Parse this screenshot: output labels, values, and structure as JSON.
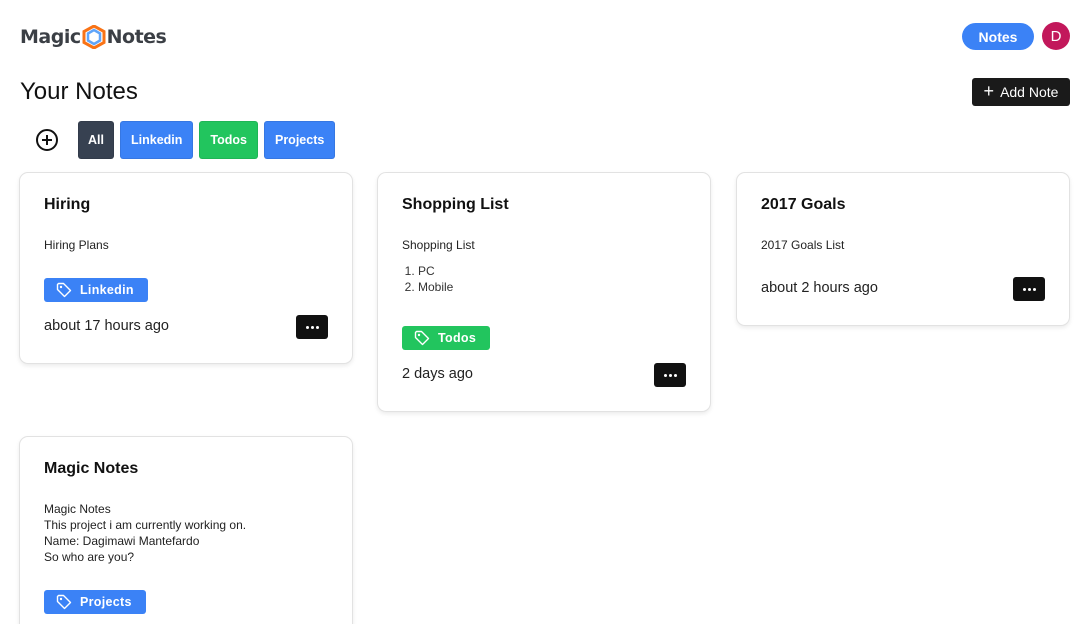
{
  "header": {
    "logo_left": "Magic",
    "logo_right": "Notes",
    "nav_notes_label": "Notes",
    "avatar_initial": "D"
  },
  "page": {
    "title": "Your Notes",
    "add_note_label": "Add Note",
    "add_note_icon": "plus-icon"
  },
  "filters": {
    "add_icon": "add-circle-icon",
    "items": [
      {
        "label": "All",
        "color": "#374151"
      },
      {
        "label": "Linkedin",
        "color": "#3b82f6"
      },
      {
        "label": "Todos",
        "color": "#22c55e"
      },
      {
        "label": "Projects",
        "color": "#3b82f6"
      }
    ]
  },
  "notes": [
    {
      "title": "Hiring",
      "body": [
        "Hiring Plans"
      ],
      "list": [],
      "tag": "Linkedin",
      "tag_color": "#3b82f6",
      "time": "about 17 hours ago"
    },
    {
      "title": "Shopping List",
      "body": [
        "Shopping List"
      ],
      "list": [
        "PC",
        "Mobile"
      ],
      "tag": "Todos",
      "tag_color": "#22c55e",
      "time": "2 days ago"
    },
    {
      "title": "2017 Goals",
      "body": [
        "2017 Goals List"
      ],
      "list": [],
      "tag": "",
      "tag_color": "",
      "time": "about 2 hours ago"
    },
    {
      "title": "Magic Notes",
      "body": [
        "Magic Notes",
        "This project i am currently working on.",
        "Name: Dagimawi Mantefardo",
        "So who are you?"
      ],
      "list": [],
      "tag": "Projects",
      "tag_color": "#3b82f6",
      "time": ""
    }
  ]
}
